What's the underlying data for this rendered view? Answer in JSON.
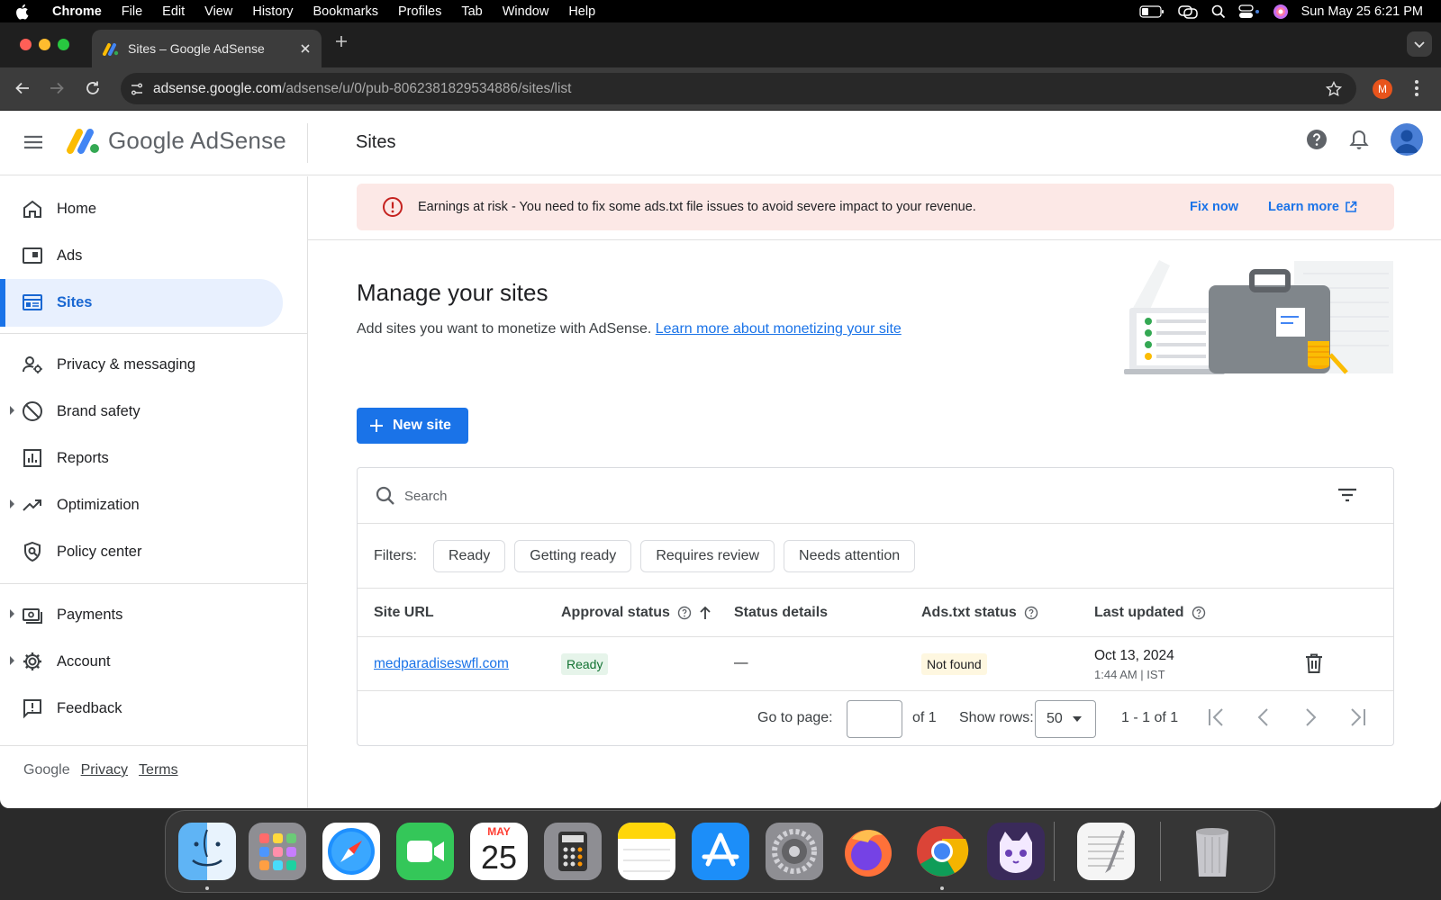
{
  "menubar": {
    "app": "Chrome",
    "items": [
      "File",
      "Edit",
      "View",
      "History",
      "Bookmarks",
      "Profiles",
      "Tab",
      "Window",
      "Help"
    ],
    "datetime": "Sun May 25  6:21 PM"
  },
  "browser": {
    "tab_title": "Sites – Google AdSense",
    "url_host": "adsense.google.com",
    "url_path": "/adsense/u/0/pub-8062381829534886/sites/list",
    "profile_initial": "M"
  },
  "header": {
    "brand": "Google AdSense",
    "page_title": "Sites"
  },
  "sidebar": {
    "items": [
      {
        "label": "Home"
      },
      {
        "label": "Ads"
      },
      {
        "label": "Sites"
      },
      {
        "label": "Privacy & messaging"
      },
      {
        "label": "Brand safety"
      },
      {
        "label": "Reports"
      },
      {
        "label": "Optimization"
      },
      {
        "label": "Policy center"
      },
      {
        "label": "Payments"
      },
      {
        "label": "Account"
      },
      {
        "label": "Feedback"
      }
    ],
    "footer": {
      "google": "Google",
      "privacy": "Privacy",
      "terms": "Terms"
    }
  },
  "alert": {
    "text": "Earnings at risk - You need to fix some ads.txt file issues to avoid severe impact to your revenue.",
    "fix_now": "Fix now",
    "learn_more": "Learn more"
  },
  "main": {
    "heading": "Manage your sites",
    "subtitle": "Add sites you want to monetize with AdSense.",
    "subtitle_link": "Learn more about monetizing your site",
    "new_site_button": "New site"
  },
  "table": {
    "search_placeholder": "Search",
    "filters_label": "Filters:",
    "filters": [
      "Ready",
      "Getting ready",
      "Requires review",
      "Needs attention"
    ],
    "columns": [
      "Site URL",
      "Approval status",
      "Status details",
      "Ads.txt status",
      "Last updated"
    ],
    "rows": [
      {
        "site_url": "medparadiseswfl.com",
        "approval_status": "Ready",
        "status_details": "—",
        "ads_txt_status": "Not found",
        "last_updated_date": "Oct 13, 2024",
        "last_updated_time": "1:44 AM | IST"
      }
    ],
    "pagination": {
      "go_to_page_label": "Go to page:",
      "go_to_page_value": "",
      "of_pages": "of 1",
      "show_rows_label": "Show rows:",
      "rows_per_page": "50",
      "range": "1 - 1 of 1"
    }
  },
  "dock": {
    "calendar_month": "MAY",
    "calendar_day": "25"
  },
  "colors": {
    "accent": "#1a73e8",
    "alert_bg": "#fce8e6",
    "alert_icon": "#c5221f",
    "ready_bg": "#e6f4ea",
    "not_found_bg": "#fef7e0"
  }
}
